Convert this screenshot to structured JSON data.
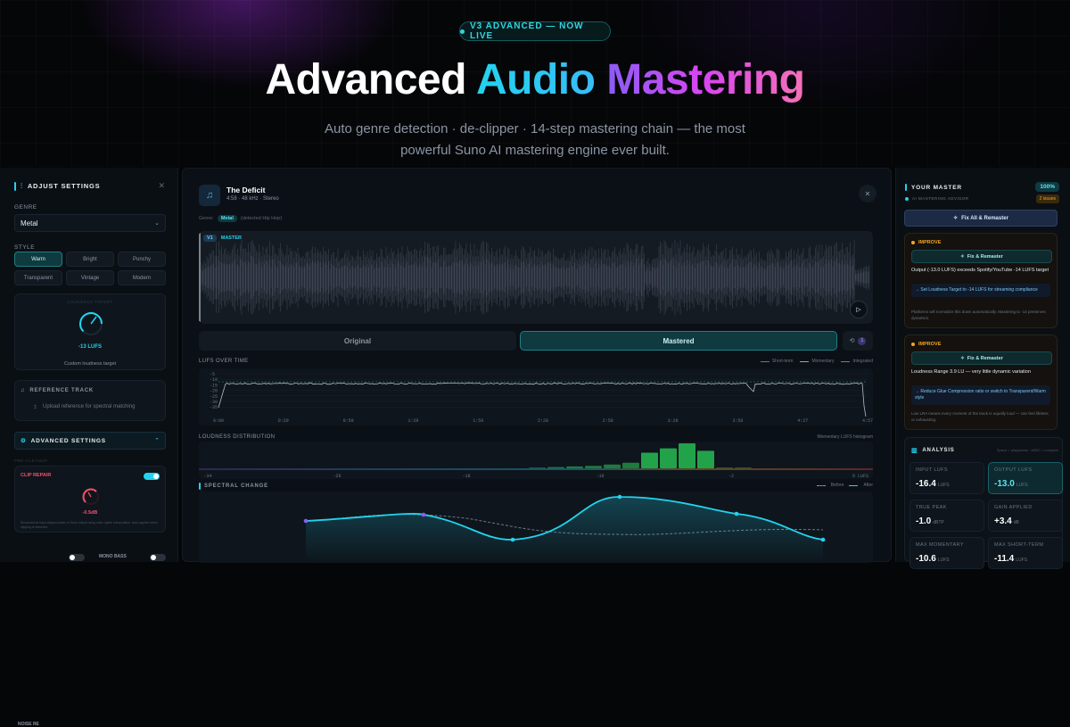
{
  "hero": {
    "badge": "V3 ADVANCED — NOW LIVE",
    "title_part1": "Advanced",
    "title_part2": "Audio",
    "title_part3": "Mastering",
    "subtitle_line1": "Auto genre detection · de-clipper · 14-step mastering chain — the most",
    "subtitle_line2": "powerful Suno AI mastering engine ever built."
  },
  "left": {
    "title": "ADJUST SETTINGS",
    "genre_label": "GENRE",
    "genre_value": "Metal",
    "style_label": "STYLE",
    "styles": [
      "Warm",
      "Bright",
      "Punchy",
      "Transparent",
      "Vintage",
      "Modern"
    ],
    "style_selected": "Warm",
    "loudness_header": "LOUDNESS TARGET",
    "loudness_value": "-13 LUFS",
    "loudness_caption": "Custom loudness target",
    "reference_title": "REFERENCE TRACK",
    "reference_upload": "Upload reference for spectral matching",
    "advanced_title": "ADVANCED SETTINGS",
    "pre_cleanup": "PRE-CLEANUP",
    "clip_repair_title": "CLIP REPAIR",
    "clip_repair_value": "-0.5dB",
    "clip_repair_desc": "Reconstructs hard-clipped peaks in Suno output using cubic spline interpolation. Auto-applies when clipping is detected.",
    "noise_label": "NOISE RE",
    "mono_bass_label": "MONO BASS"
  },
  "center": {
    "track_title": "The Deficit",
    "track_meta": "4:58 · 48 kHz · Stereo",
    "genre_label": "Genre:",
    "genre_chip": "Metal",
    "genre_detected": "(detected Hip Hop)",
    "wave_badge": "V1",
    "wave_label": "MASTER",
    "tab_original": "Original",
    "tab_mastered": "Mastered",
    "history_count": "1",
    "lufs_title": "LUFS OVER TIME",
    "legend": [
      "Short-term",
      "Momentary",
      "Integrated"
    ],
    "lufs_y_ticks": [
      "-5",
      "-10",
      "-15",
      "-20",
      "-25",
      "-30",
      "-35"
    ],
    "lufs_x_ticks": [
      "0:00",
      "0:29",
      "0:59",
      "1:29",
      "1:59",
      "2:28",
      "2:58",
      "3:28",
      "3:58",
      "4:27",
      "4:57"
    ],
    "dist_title": "LOUDNESS DISTRIBUTION",
    "dist_caption": "Momentary LUFS histogram",
    "dist_x_ticks": [
      "-34",
      "-26",
      "-18",
      "-10",
      "-2",
      "0 LUFS"
    ],
    "spectral_title": "SPECTRAL CHANGE",
    "spectral_before": "Before",
    "spectral_after": "After",
    "accent": "#22d3ee"
  },
  "right": {
    "title": "YOUR MASTER",
    "score": "100%",
    "advisor_label": "AI MASTERING ADVISOR",
    "issues": "2 issues",
    "fix_all": "Fix All & Remaster",
    "cards": [
      {
        "tag": "IMPROVE",
        "button": "Fix & Remaster",
        "text": "Output (-13.0 LUFS) exceeds Spotify/YouTube -14 LUFS target",
        "action": "→ Set Loudness Target to -14 LUFS for streaming compliance",
        "note": "Platforms will normalize this down automatically. Mastering to -14 preserves dynamics."
      },
      {
        "tag": "IMPROVE",
        "button": "Fix & Remaster",
        "text": "Loudness Range 3.9 LU — very little dynamic variation",
        "action": "→ Reduce Glue Compression ratio or switch to Transparent/Warm style",
        "note": "Low LRA means every moment of the track is equally loud — can feel lifeless or exhausting."
      }
    ],
    "analysis_title": "ANALYSIS",
    "analysis_hint": "Space = play/pause · A/B/C = compare",
    "stats": [
      {
        "k": "INPUT LUFS",
        "v": "-16.4",
        "u": "LUFS"
      },
      {
        "k": "OUTPUT LUFS",
        "v": "-13.0",
        "u": "LUFS"
      },
      {
        "k": "TRUE PEAK",
        "v": "-1.0",
        "u": "dBTP"
      },
      {
        "k": "GAIN APPLIED",
        "v": "+3.4",
        "u": "dB"
      },
      {
        "k": "MAX MOMENTARY",
        "v": "-10.6",
        "u": "LUFS"
      },
      {
        "k": "MAX SHORT-TERM",
        "v": "-11.4",
        "u": "LUFS"
      }
    ]
  },
  "chart_data": {
    "type": "bar",
    "title": "LOUDNESS DISTRIBUTION",
    "categories": [
      "-22",
      "-21",
      "-20",
      "-19",
      "-18",
      "-17",
      "-16",
      "-15",
      "-14",
      "-13",
      "-12",
      "-11"
    ],
    "values": [
      1,
      2,
      3,
      4,
      6,
      9,
      25,
      32,
      40,
      28,
      1,
      1
    ]
  }
}
